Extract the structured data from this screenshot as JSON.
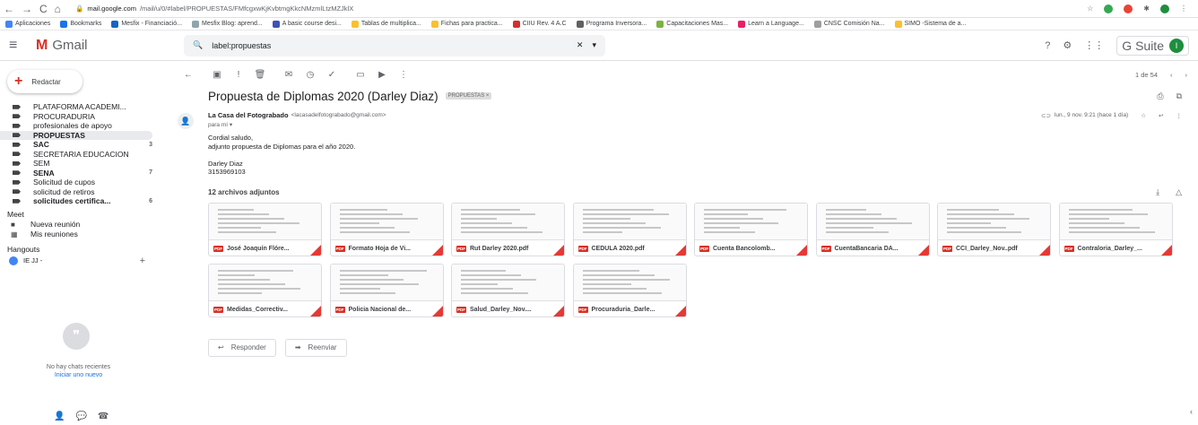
{
  "browser": {
    "url_domain": "mail.google.com",
    "url_path": "/mail/u/0/#label/PROPUESTAS/FMfcgxwKjKvbtmgKkcNMzmlLtzMZJklX"
  },
  "bookmarks": [
    {
      "label": "Aplicaciones",
      "color": "#4285f4"
    },
    {
      "label": "Bookmarks",
      "color": "#1a73e8"
    },
    {
      "label": "Mesfix - Financiació...",
      "color": "#1565c0"
    },
    {
      "label": "Mesfix Blog: aprend...",
      "color": "#90a4ae"
    },
    {
      "label": "A basic course desi...",
      "color": "#3f51b5"
    },
    {
      "label": "Tablas de multiplica...",
      "color": "#fbc02d"
    },
    {
      "label": "Fichas para practica...",
      "color": "#fbc02d"
    },
    {
      "label": "CIIU Rev. 4 A.C",
      "color": "#d32f2f"
    },
    {
      "label": "Programa Inversora...",
      "color": "#616161"
    },
    {
      "label": "Capacitaciones Mas...",
      "color": "#7cb342"
    },
    {
      "label": "Learn a Language...",
      "color": "#e91e63"
    },
    {
      "label": "CNSC Comisión Na...",
      "color": "#9e9e9e"
    },
    {
      "label": "SIMO -Sistema de a...",
      "color": "#fbc02d"
    }
  ],
  "header": {
    "app_name": "Gmail",
    "search_value": "label:propuestas",
    "suite": "G Suite",
    "avatar": "I"
  },
  "sidebar": {
    "compose": "Redactar",
    "labels": [
      {
        "label": "PLATAFORMA ACADEMI...",
        "count": "",
        "bold": false,
        "selected": false
      },
      {
        "label": "PROCURADURIA",
        "count": "",
        "bold": false,
        "selected": false
      },
      {
        "label": "profesionales de apoyo",
        "count": "",
        "bold": false,
        "selected": false
      },
      {
        "label": "PROPUESTAS",
        "count": "",
        "bold": true,
        "selected": true
      },
      {
        "label": "SAC",
        "count": "3",
        "bold": true,
        "selected": false
      },
      {
        "label": "SECRETARIA EDUCACION",
        "count": "",
        "bold": false,
        "selected": false
      },
      {
        "label": "SEM",
        "count": "",
        "bold": false,
        "selected": false
      },
      {
        "label": "SENA",
        "count": "7",
        "bold": true,
        "selected": false
      },
      {
        "label": "Solicitud de cupos",
        "count": "",
        "bold": false,
        "selected": false
      },
      {
        "label": "solicitud de retiros",
        "count": "",
        "bold": false,
        "selected": false
      },
      {
        "label": "solicitudes certifica...",
        "count": "6",
        "bold": true,
        "selected": false
      }
    ],
    "meet_title": "Meet",
    "meet_new": "Nueva reunión",
    "meet_mine": "Mis reuniones",
    "hangouts_title": "Hangouts",
    "hangouts_user": "IE JJ -",
    "no_chats": "No hay chats recientes",
    "start_new": "Iniciar uno nuevo"
  },
  "toolbar": {
    "page": "1 de 54"
  },
  "email": {
    "subject": "Propuesta de Diplomas 2020 (Darley Diaz)",
    "chip": "PROPUESTAS ×",
    "sender_name": "La Casa del Fotograbado",
    "sender_email": "<lacasadelfotograbado@gmail.com>",
    "to": "para mí ▾",
    "date": "lun., 9 nov. 9:21 (hace 1 día)",
    "body": [
      "Cordial saludo,",
      "adjunto propuesta de Diplomas para el año 2020.",
      "",
      "Darley Diaz",
      "3153969103"
    ]
  },
  "attachments_title": "12 archivos adjuntos",
  "attachments": [
    "José Joaquín Flóre...",
    "Formato Hoja de Vi...",
    "Rut Darley 2020.pdf",
    "CEDULA 2020.pdf",
    "Cuenta Bancolomb...",
    "CuentaBancaria DA...",
    "CCI_Darley_Nov..pdf",
    "Contraloria_Darley_...",
    "Medidas_Correctiv...",
    "Policia Nacional de...",
    "Salud_Darley_Nov....",
    "Procuraduria_Darle..."
  ],
  "actions": {
    "reply": "Responder",
    "forward": "Reenviar"
  }
}
